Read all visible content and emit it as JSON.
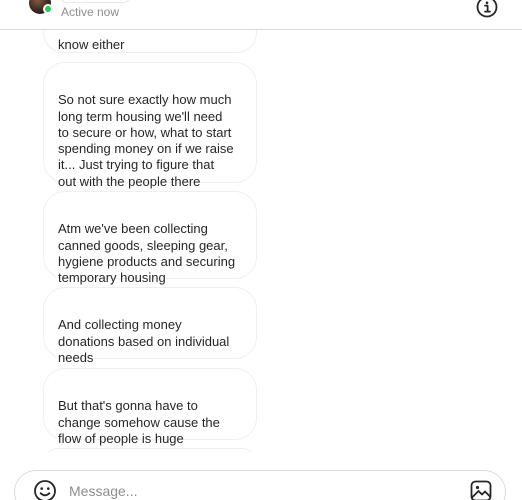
{
  "header": {
    "status": "Active now",
    "colors": {
      "presence": "#1cd14f",
      "status_text": "#8e8e8e"
    },
    "icons": {
      "info": "info-icon"
    }
  },
  "thread": {
    "messages": [
      {
        "text": "know either"
      },
      {
        "text": "So not sure exactly how much\nlong term housing we'll need\nto secure or how, what to start\nspending money on if we raise\nit... Just trying to figure that\nout with the people there"
      },
      {
        "text": "Atm we've been collecting\ncanned goods, sleeping gear,\nhygiene products and securing\ntemporary housing"
      },
      {
        "text": "And collecting money\ndonations based on individual\nneeds"
      },
      {
        "text": "But that's gonna have to\nchange somehow cause the\nflow of people is huge"
      },
      {
        "text": ""
      }
    ],
    "colors": {
      "bubble_border": "#efefef",
      "text": "#262626"
    }
  },
  "composer": {
    "placeholder": "Message...",
    "value": "",
    "icons": {
      "emoji": "smiley-icon",
      "gallery": "image-icon"
    }
  }
}
